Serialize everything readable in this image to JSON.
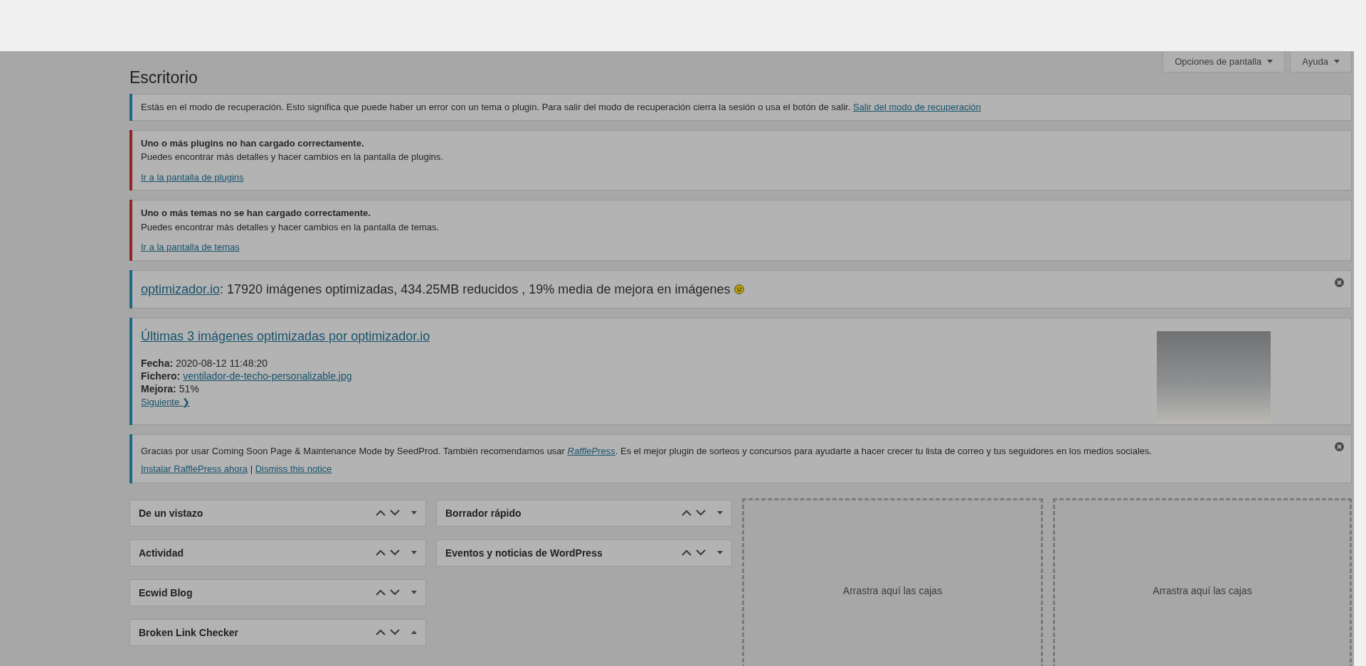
{
  "header_buttons": [
    {
      "label": "Opciones de pantalla"
    },
    {
      "label": "Ayuda"
    }
  ],
  "page_title": "Escritorio",
  "notices": [
    {
      "kind": "recovery",
      "color": "#1c6a85",
      "text": "Estás en el modo de recuperación. Esto significa que puede haber un error con un tema o plugin. Para salir del modo de recuperación cierra la sesión o usa el botón de salir.",
      "link": "Salir del modo de recuperación"
    },
    {
      "kind": "error",
      "color": "#952323",
      "title": "Uno o más plugins no han cargado correctamente.",
      "text": "Puedes encontrar más detalles y hacer cambios en la pantalla de plugins.",
      "link": "Ir a la pantalla de plugins"
    },
    {
      "kind": "error",
      "color": "#952323",
      "title": "Uno o más temas no se han cargado correctamente.",
      "text": "Puedes encontrar más detalles y hacer cambios en la pantalla de temas.",
      "link": "Ir a la pantalla de temas"
    },
    {
      "kind": "stats",
      "color": "#1c6a85",
      "link": "optimizador.io",
      "text": ": 17920 imágenes optimizadas, 434.25MB reducidos , 19% media de mejora en imágenes",
      "dismissible": true
    },
    {
      "kind": "recent",
      "color": "#1c6a85",
      "title": "Últimas 3 imágenes optimizadas por optimizador.io",
      "fields": [
        {
          "kind": "text",
          "label": "Fecha:",
          "value": "2020-08-12 11:48:20"
        },
        {
          "kind": "link",
          "label": "Fichero:",
          "value": "ventilador-de-techo-personalizable.jpg"
        },
        {
          "kind": "text",
          "label": "Mejora:",
          "value": "51%"
        }
      ],
      "next": "Siguiente ❯"
    },
    {
      "kind": "promo",
      "color": "#1c6a85",
      "text_before": "Gracias por usar Coming Soon Page & Maintenance Mode by SeedProd. También recomendamos usar ",
      "link": "RafflePress",
      "text_after": ". Es el mejor plugin de sorteos y concursos para ayudarte a hacer crecer tu lista de correo y tus seguidores en los medios sociales.",
      "links": [
        "Instalar RafflePress ahora",
        "Dismiss this notice"
      ],
      "separator": "|",
      "dismissible": true
    }
  ],
  "columns": [
    {
      "kind": "boxes",
      "boxes": [
        {
          "title": "De un vistazo",
          "expanded": false
        },
        {
          "title": "Actividad",
          "expanded": false
        },
        {
          "title": "Ecwid Blog",
          "expanded": false
        },
        {
          "title": "Broken Link Checker",
          "expanded": true
        }
      ]
    },
    {
      "kind": "boxes",
      "boxes": [
        {
          "title": "Borrador rápido",
          "expanded": false
        },
        {
          "title": "Eventos y noticias de WordPress",
          "expanded": false
        }
      ]
    },
    {
      "kind": "drop",
      "text": "Arrastra aquí las cajas"
    },
    {
      "kind": "drop",
      "text": "Arrastra aquí las cajas"
    }
  ]
}
